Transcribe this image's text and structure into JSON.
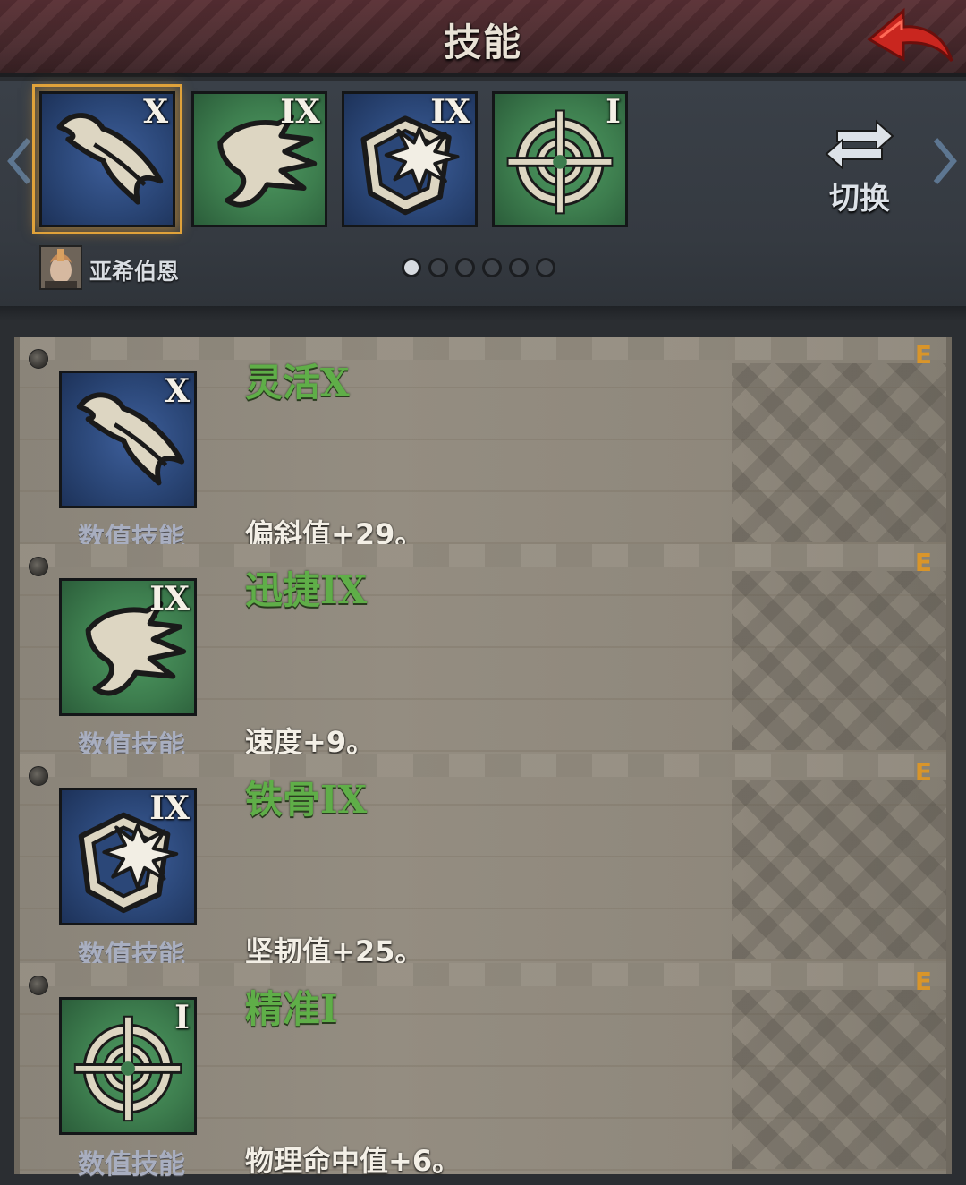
{
  "header": {
    "title": "技能"
  },
  "strip": {
    "slots": [
      {
        "numeral": "X",
        "color": "#2b4778",
        "icon": "feather-skill-icon",
        "selected": true
      },
      {
        "numeral": "IX",
        "color": "#3d7d4e",
        "icon": "winged-boot-skill-icon",
        "selected": false
      },
      {
        "numeral": "IX",
        "color": "#2b4778",
        "icon": "cracked-shield-skill-icon",
        "selected": false
      },
      {
        "numeral": "I",
        "color": "#3d7d4e",
        "icon": "crosshair-skill-icon",
        "selected": false
      }
    ],
    "swap_label": "切换",
    "hero_name": "亚希伯恩",
    "page_dots": 6,
    "active_dot": 0
  },
  "skills": [
    {
      "name": "灵活X",
      "type": "数值技能",
      "numeral": "X",
      "desc": "偏斜值+29。",
      "marker": "E"
    },
    {
      "name": "迅捷IX",
      "type": "数值技能",
      "numeral": "IX",
      "desc": "速度+9。",
      "marker": "E"
    },
    {
      "name": "铁骨IX",
      "type": "数值技能",
      "numeral": "IX",
      "desc": "坚韧值+25。",
      "marker": "E"
    },
    {
      "name": "精准I",
      "type": "数值技能",
      "numeral": "I",
      "desc": "物理命中值+6。",
      "marker": "E"
    }
  ],
  "colors": {
    "accent_gold": "#e0a23a",
    "skill_green": "#5fae48",
    "tile_blue": "#2b4778",
    "tile_green": "#3d7d4e",
    "back_red": "#c9261f"
  }
}
